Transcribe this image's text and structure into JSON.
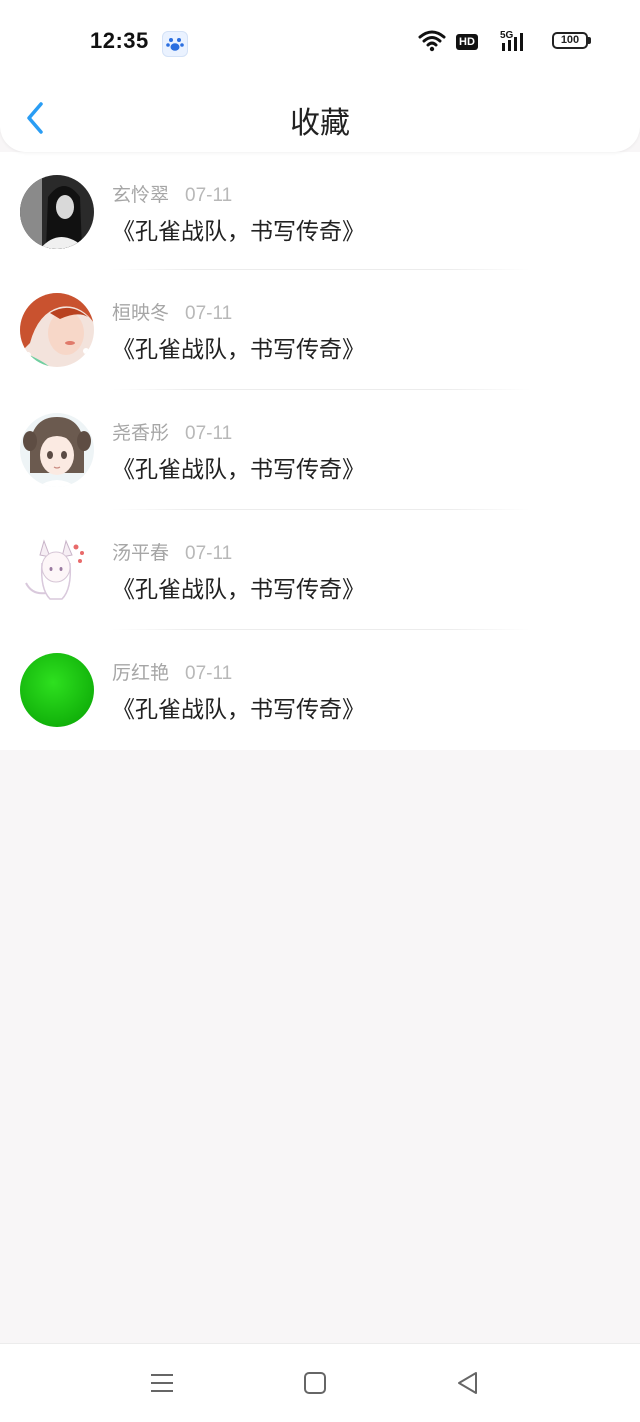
{
  "status_bar": {
    "time": "12:35",
    "app_icon": "baidu-paw-icon",
    "hd_label": "HD",
    "network_label": "5G",
    "battery": "100"
  },
  "nav": {
    "title": "收藏",
    "back_icon": "chevron-left-icon",
    "accent_color": "#2a9df4"
  },
  "favorites": [
    {
      "name": "玄怜翠",
      "date": "07-11",
      "content": "《孔雀战队，书写传奇》",
      "avatar": "grayscale-photo-avatar"
    },
    {
      "name": "桓映冬",
      "date": "07-11",
      "content": "《孔雀战队，书写传奇》",
      "avatar": "red-hair-portrait-avatar"
    },
    {
      "name": "尧香彤",
      "date": "07-11",
      "content": "《孔雀战队，书写传奇》",
      "avatar": "anime-girl-avatar"
    },
    {
      "name": "汤平春",
      "date": "07-11",
      "content": "《孔雀战队，书写传奇》",
      "avatar": "fox-girl-sketch-avatar"
    },
    {
      "name": "厉红艳",
      "date": "07-11",
      "content": "《孔雀战队，书写传奇》",
      "avatar": "green-circle-avatar"
    }
  ],
  "system_nav": {
    "menu_icon": "menu-icon",
    "home_icon": "home-square-icon",
    "back_icon": "back-triangle-icon"
  }
}
